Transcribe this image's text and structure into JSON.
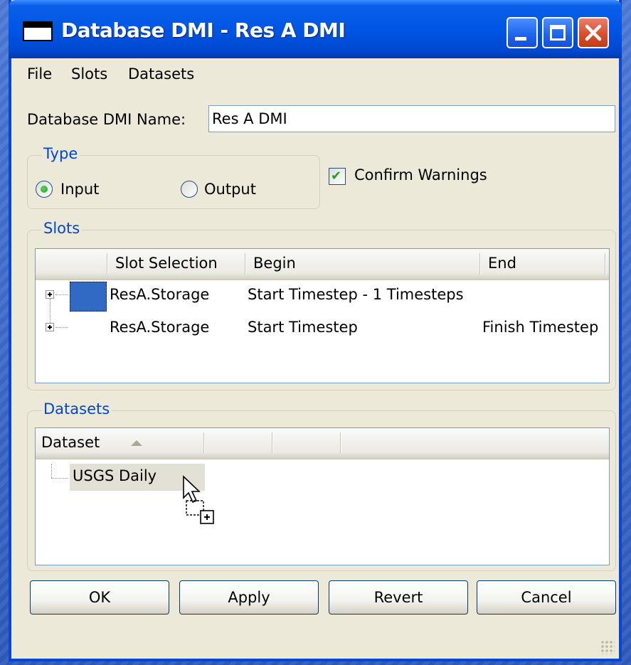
{
  "window": {
    "title": "Database DMI - Res A DMI",
    "controls": {
      "minimize": "minimize",
      "maximize": "maximize",
      "close": "close"
    }
  },
  "menu": [
    "File",
    "Slots",
    "Datasets"
  ],
  "name_field": {
    "label": "Database DMI Name:",
    "value": "Res A DMI"
  },
  "type_group": {
    "title": "Type",
    "options": [
      {
        "label": "Input",
        "selected": true
      },
      {
        "label": "Output",
        "selected": false
      }
    ]
  },
  "confirm_warnings": {
    "label": "Confirm Warnings",
    "checked": true
  },
  "slots_group": {
    "title": "Slots",
    "columns": [
      "Slot Selection",
      "Begin",
      "End"
    ],
    "rows": [
      {
        "slot": "ResA.Storage",
        "begin": "Start Timestep - 1 Timesteps",
        "end": "",
        "selected": true
      },
      {
        "slot": "ResA.Storage",
        "begin": "Start Timestep",
        "end": "Finish Timestep",
        "selected": false
      }
    ]
  },
  "datasets_group": {
    "title": "Datasets",
    "columns": [
      "Dataset",
      "",
      "",
      ""
    ],
    "sort_indicator": "ascending",
    "items": [
      {
        "label": "USGS Daily"
      }
    ]
  },
  "buttons": {
    "ok": "OK",
    "apply": "Apply",
    "revert": "Revert",
    "cancel": "Cancel"
  },
  "colors": {
    "title_bar": "#0055e5",
    "selection": "#316ac5",
    "group_title": "#0046d5",
    "dialog_bg": "#ece9d8"
  }
}
